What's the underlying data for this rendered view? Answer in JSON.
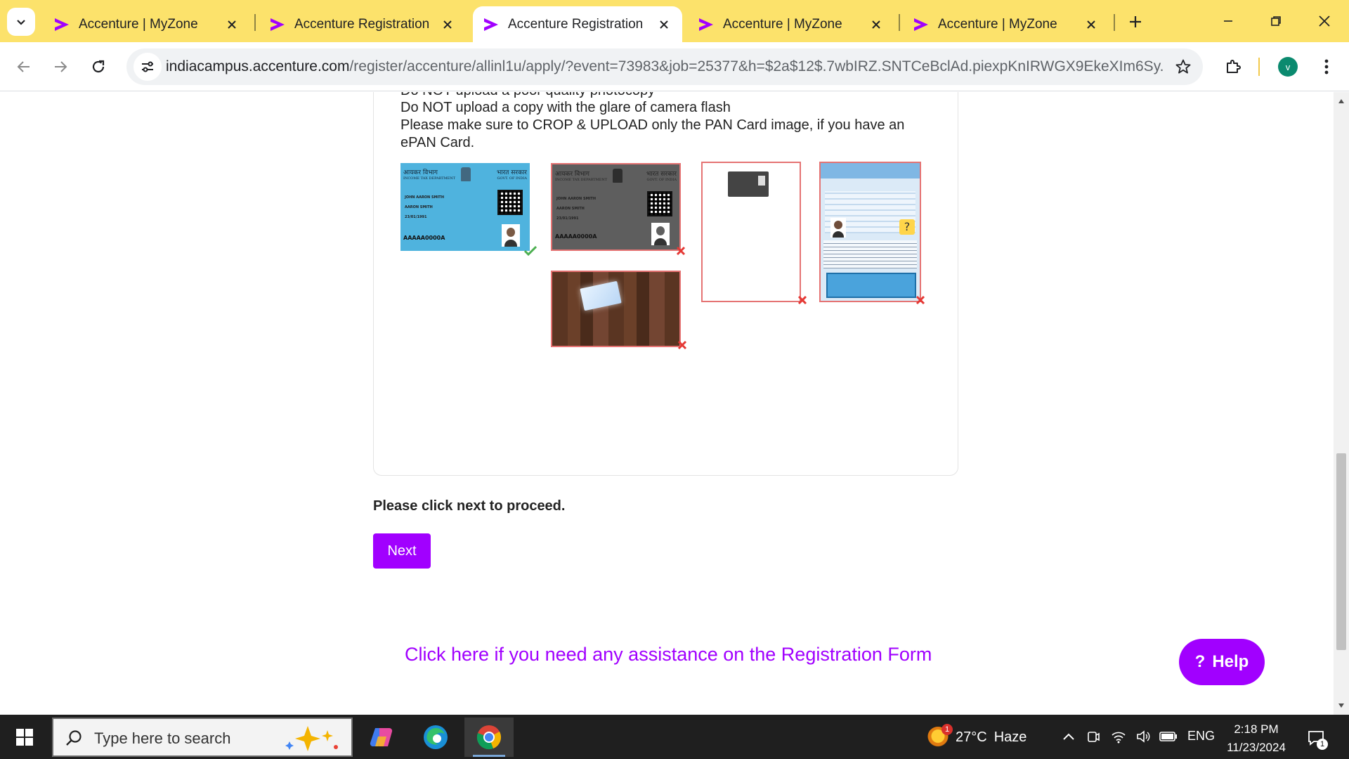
{
  "browser": {
    "tabs": [
      {
        "title": "Accenture | MyZone",
        "active": false
      },
      {
        "title": "Accenture Registration",
        "active": false
      },
      {
        "title": "Accenture Registration",
        "active": true
      },
      {
        "title": "Accenture | MyZone",
        "active": false
      },
      {
        "title": "Accenture | MyZone",
        "active": false
      }
    ],
    "url_host": "indiacampus.accenture.com",
    "url_path": "/register/accenture/allinl1u/apply/?event=73983&job=25377&h=$2a$12$.7wbIRZ.SNTCeBclAd.piexpKnIRWGX9EkeXIm6Sy...",
    "profile_initial": "v",
    "icons": {
      "tab_list": "chevron-down-icon",
      "favicon": "accenture-chevron-icon",
      "close": "close-icon",
      "new_tab": "plus-icon",
      "back": "arrow-left-icon",
      "forward": "arrow-right-icon",
      "reload": "reload-icon",
      "site_info": "tune-icon",
      "bookmark": "star-icon",
      "extensions": "puzzle-icon",
      "menu": "kebab-menu-icon"
    }
  },
  "page": {
    "instructions": {
      "cut_line": "Do NOT upload a poor quality photocopy",
      "line2": "Do NOT upload a copy with the glare of camera flash",
      "line3": "Please make sure to CROP & UPLOAD only the PAN Card image, if you have an",
      "line4": "ePAN Card."
    },
    "samples": [
      {
        "kind": "pan-card-color",
        "accepted": true,
        "number": "AAAAA0000A",
        "name": "JOHN AARON SMITH",
        "father": "AARON SMITH",
        "dob": "23/01/1991"
      },
      {
        "kind": "pan-card-grayscale",
        "accepted": false,
        "number": "AAAAA0000A",
        "name": "JOHN AARON SMITH",
        "father": "AARON SMITH",
        "dob": "23/01/1991"
      },
      {
        "kind": "pan-card-on-wood-with-glare",
        "accepted": false
      },
      {
        "kind": "uncropped-pdf-page",
        "accepted": false
      },
      {
        "kind": "full-epan-document",
        "accepted": false
      }
    ],
    "card_header_left": "आयकर विभाग",
    "card_header_left_sub": "INCOME TAX DEPARTMENT",
    "card_header_right": "भारत सरकार",
    "card_header_right_sub": "GOVT. OF INDIA",
    "proceed_text": "Please click next to proceed.",
    "next_label": "Next",
    "assistance_link": "Click here if you need any assistance on the Registration Form",
    "help_label": "Help",
    "help_icon": "?",
    "colors": {
      "accent": "#a100ff",
      "tab_strip": "#fce26b",
      "accepted": "#4caf50",
      "rejected": "#e53935"
    }
  },
  "taskbar": {
    "search_placeholder": "Type here to search",
    "weather_temp": "27°C",
    "weather_desc": "Haze",
    "weather_badge": "1",
    "language": "ENG",
    "time": "2:18 PM",
    "date": "11/23/2024",
    "notification_count": "1",
    "apps": [
      "copilot-icon",
      "edge-icon",
      "chrome-icon"
    ]
  }
}
